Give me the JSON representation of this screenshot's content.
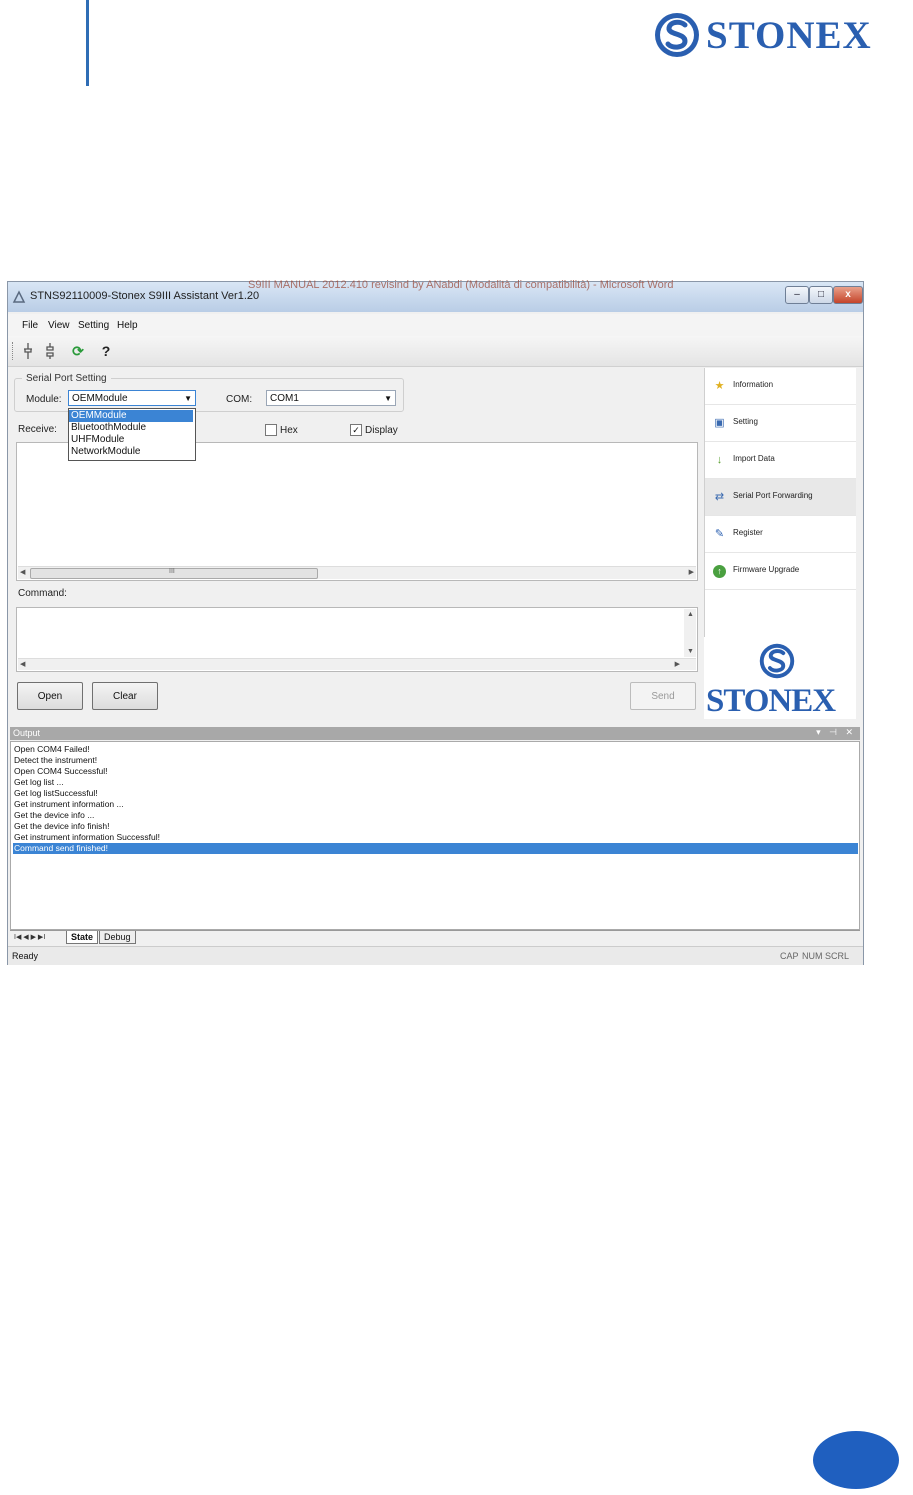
{
  "page": {
    "brand": "STONEX",
    "accent_color": "#1f5fbf"
  },
  "window": {
    "title": "STNS92110009-Stonex S9III Assistant Ver1.20",
    "background_title": "S9III MANUAL 2012.410 revisind  by  ANabdi (Modalità di compatibilità) - Microsoft Word",
    "controls": {
      "minimize": "–",
      "maximize": "□",
      "close": "x"
    },
    "menu": [
      "File",
      "View",
      "Setting",
      "Help"
    ],
    "toolbar_icons": [
      "connect-icon",
      "disconnect-icon",
      "refresh-icon",
      "help-icon"
    ],
    "serial_port": {
      "legend": "Serial Port Setting",
      "module_label": "Module:",
      "module_value": "OEMModule",
      "module_options": [
        "OEMModule",
        "BluetoothModule",
        "UHFModule",
        "NetworkModule"
      ],
      "com_label": "COM:",
      "com_value": "COM1"
    },
    "receive": {
      "label": "Receive:",
      "hex_label": "Hex",
      "hex_checked": false,
      "display_label": "Display",
      "display_checked": true,
      "scroll_mark": "III"
    },
    "command": {
      "label": "Command:"
    },
    "buttons": {
      "open": "Open",
      "clear": "Clear",
      "send": "Send"
    },
    "nav": [
      {
        "label": "Information",
        "icon": "star-icon"
      },
      {
        "label": "Setting",
        "icon": "settings-icon"
      },
      {
        "label": "Import Data",
        "icon": "import-icon"
      },
      {
        "label": "Serial Port Forwarding",
        "icon": "forwarding-icon",
        "selected": true
      },
      {
        "label": "Register",
        "icon": "register-icon"
      },
      {
        "label": "Firmware Upgrade",
        "icon": "firmware-icon"
      }
    ],
    "logo_text": "STONEX",
    "output": {
      "title": "Output",
      "controls": "▾ ⊣ ✕",
      "lines": [
        "Open COM4 Failed!",
        "Detect the instrument!",
        "Open COM4 Successful!",
        "Get log list ...",
        "Get log listSuccessful!",
        "Get instrument information ...",
        "Get the device info ...",
        "Get the device info finish!",
        "Get instrument information Successful!",
        "Command send finished!"
      ],
      "selected_line": 9,
      "tab_nav": "I◀  ◀  ▶  ▶I",
      "tabs": [
        "State",
        "Debug"
      ]
    },
    "status": {
      "text": "Ready",
      "indicators": [
        "CAP",
        "NUM",
        "SCRL"
      ]
    }
  }
}
